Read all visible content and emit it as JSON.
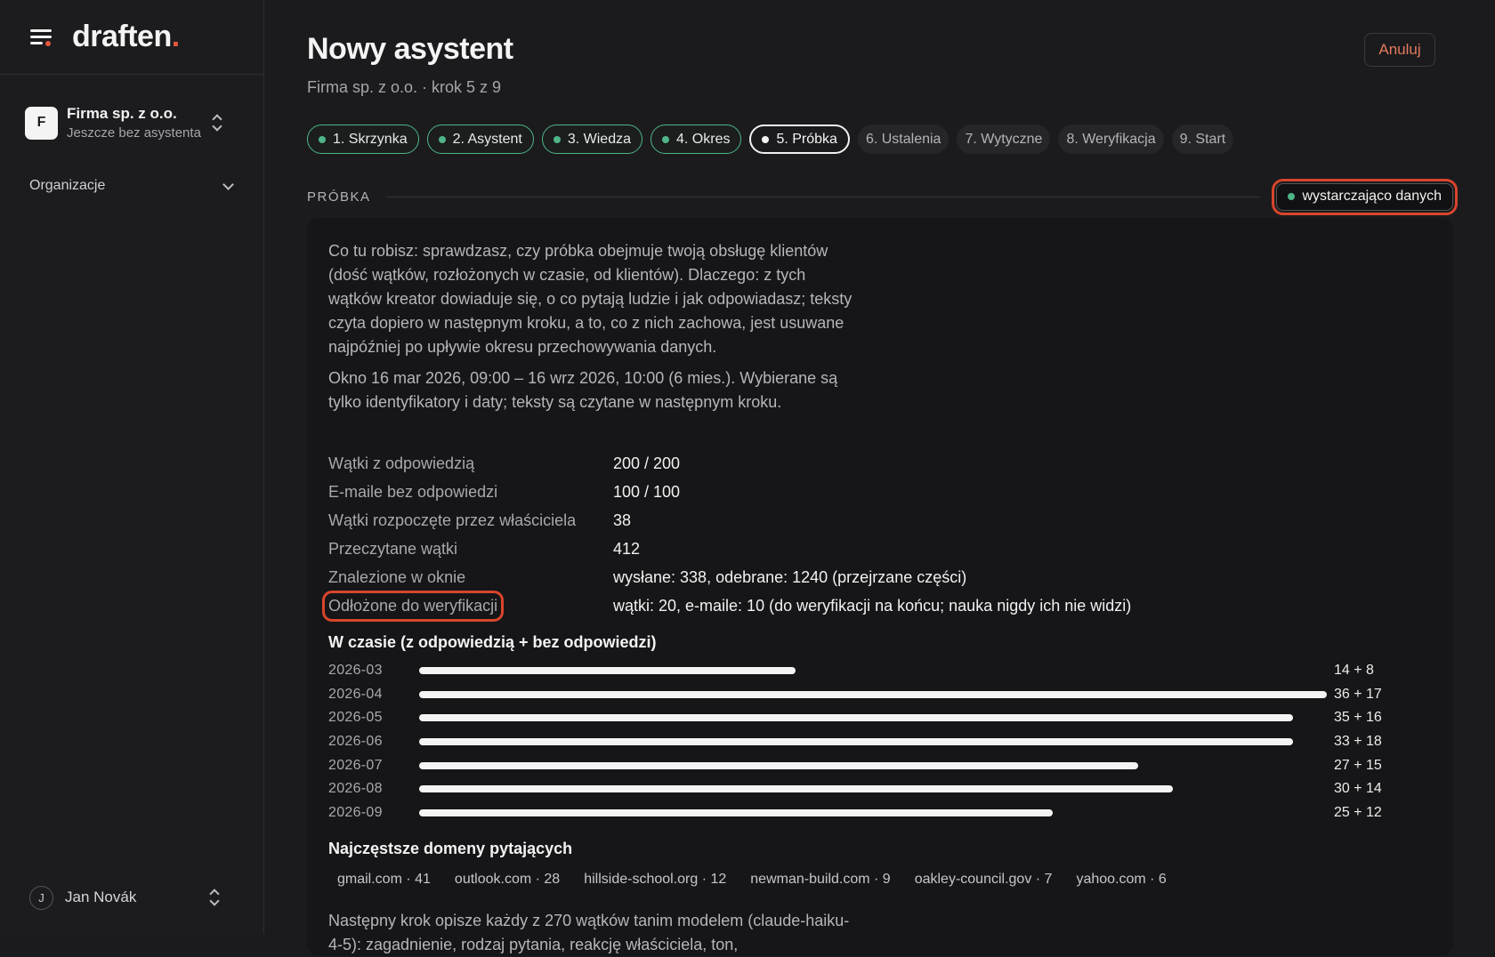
{
  "app": {
    "logo_text": "draften",
    "logo_dot": "."
  },
  "sidebar": {
    "org_initial": "F",
    "org_name": "Firma sp. z o.o.",
    "org_sub": "Jeszcze bez asystenta",
    "section_label": "Organizacje",
    "user_initial": "J",
    "user_name": "Jan Novák"
  },
  "header": {
    "title": "Nowy asystent",
    "subtitle": "Firma sp. z o.o. · krok 5 z 9",
    "cancel_label": "Anuluj"
  },
  "steps": [
    {
      "label": "1. Skrzynka",
      "state": "done"
    },
    {
      "label": "2. Asystent",
      "state": "done"
    },
    {
      "label": "3. Wiedza",
      "state": "done"
    },
    {
      "label": "4. Okres",
      "state": "done"
    },
    {
      "label": "5. Próbka",
      "state": "current"
    },
    {
      "label": "6. Ustalenia",
      "state": "future"
    },
    {
      "label": "7. Wytyczne",
      "state": "future"
    },
    {
      "label": "8. Weryfikacja",
      "state": "future"
    },
    {
      "label": "9. Start",
      "state": "future"
    }
  ],
  "section": {
    "label": "PRÓBKA",
    "status": "wystarczająco danych",
    "status_color": "#4fb589"
  },
  "panel": {
    "intro": "Co tu robisz: sprawdzasz, czy próbka obejmuje twoją obsługę klientów (dość wątków, rozłożonych w czasie, od klientów). Dlaczego: z tych wątków kreator dowiaduje się, o co pytają ludzie i jak odpowiadasz; teksty czyta dopiero w następnym kroku, a to, co z nich zachowa, jest usuwane najpóźniej po upływie okresu przechowywania danych.",
    "window_note": "Okno 16 mar 2026, 09:00 – 16 wrz 2026, 10:00 (6 mies.). Wybierane są tylko identyfikatory i daty; teksty są czytane w następnym kroku.",
    "stats": [
      {
        "key": "Wątki z odpowiedzią",
        "value": "200 / 200"
      },
      {
        "key": "E-maile bez odpowiedzi",
        "value": "100 / 100"
      },
      {
        "key": "Wątki rozpoczęte przez właściciela",
        "value": "38"
      },
      {
        "key": "Przeczytane wątki",
        "value": "412"
      },
      {
        "key": "Znalezione w oknie",
        "value": "wysłane: 338, odebrane: 1240 (przejrzane części)"
      },
      {
        "key": "Odłożone do weryfikacji",
        "value": "wątki: 20, e-maile: 10 (do weryfikacji na końcu; nauka nigdy ich nie widzi)"
      }
    ],
    "time_title": "W czasie (z odpowiedzią + bez odpowiedzi)",
    "domains_title": "Najczęstsze domeny pytających",
    "domains": [
      "gmail.com · 41",
      "outlook.com · 28",
      "hillside-school.org · 12",
      "newman-build.com · 9",
      "oakley-council.gov · 7",
      "yahoo.com · 6"
    ],
    "next_note": "Następny krok opisze każdy z 270 wątków tanim modelem (claude-haiku-4-5): zagadnienie, rodzaj pytania, reakcję właściciela, ton,"
  },
  "chart_data": {
    "type": "bar",
    "orientation": "horizontal",
    "title": "W czasie (z odpowiedzią + bez odpowiedzi)",
    "categories": [
      "2026-03",
      "2026-04",
      "2026-05",
      "2026-06",
      "2026-07",
      "2026-08",
      "2026-09"
    ],
    "series": [
      {
        "name": "z odpowiedzią",
        "values": [
          14,
          36,
          35,
          33,
          27,
          30,
          25
        ]
      },
      {
        "name": "bez odpowiedzi",
        "values": [
          8,
          17,
          16,
          18,
          15,
          14,
          12
        ]
      }
    ],
    "labels": [
      "14 + 8",
      "36 + 17",
      "35 + 16",
      "33 + 18",
      "27 + 15",
      "30 + 14",
      "25 + 12"
    ],
    "bar_color": "#f4f4f4"
  }
}
